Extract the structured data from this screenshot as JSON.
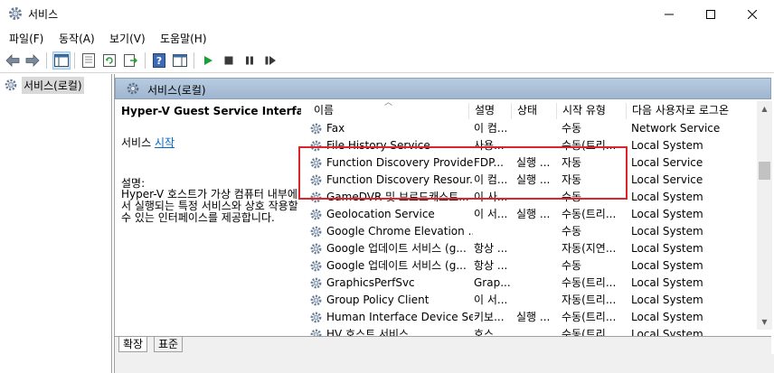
{
  "window": {
    "title": "서비스"
  },
  "menu": [
    "파일(F)",
    "동작(A)",
    "보기(V)",
    "도움말(H)"
  ],
  "tree": {
    "root_label": "서비스(로컬)"
  },
  "pane": {
    "header": "서비스(로컬)"
  },
  "description": {
    "service_name": "Hyper-V Guest Service Interface",
    "start_prefix": "서비스 ",
    "start_link": "시작",
    "label": "설명:",
    "body": "Hyper-V 호스트가 가상 컴퓨터 내부에서 실행되는 특정 서비스와 상호 작용할 수 있는 인터페이스를 제공합니다."
  },
  "columns": {
    "name": "이름",
    "desc": "설명",
    "status": "상태",
    "startup": "시작 유형",
    "logon": "다음 사용자로 로그온"
  },
  "rows": [
    {
      "name": "Fax",
      "desc": "이 컴...",
      "status": "",
      "startup": "수동",
      "logon": "Network Service"
    },
    {
      "name": "File History Service",
      "desc": "사용...",
      "status": "",
      "startup": "수동(트리...",
      "logon": "Local System"
    },
    {
      "name": "Function Discovery Provide...",
      "desc": "FDP...",
      "status": "실행 ...",
      "startup": "자동",
      "logon": "Local Service"
    },
    {
      "name": "Function Discovery Resour...",
      "desc": "이 컴...",
      "status": "실행 ...",
      "startup": "자동",
      "logon": "Local Service"
    },
    {
      "name": "GameDVR 및 브로드캐스트...",
      "desc": "이 사...",
      "status": "",
      "startup": "수동",
      "logon": "Local System"
    },
    {
      "name": "Geolocation Service",
      "desc": "이 서...",
      "status": "실행 ...",
      "startup": "수동(트리...",
      "logon": "Local System"
    },
    {
      "name": "Google Chrome Elevation ...",
      "desc": "",
      "status": "",
      "startup": "수동",
      "logon": "Local System"
    },
    {
      "name": "Google 업데이트 서비스 (g...",
      "desc": "항상 ...",
      "status": "",
      "startup": "자동(지연...",
      "logon": "Local System"
    },
    {
      "name": "Google 업데이트 서비스 (g...",
      "desc": "항상 ...",
      "status": "",
      "startup": "수동",
      "logon": "Local System"
    },
    {
      "name": "GraphicsPerfSvc",
      "desc": "Grap...",
      "status": "",
      "startup": "수동(트리...",
      "logon": "Local System"
    },
    {
      "name": "Group Policy Client",
      "desc": "이 서...",
      "status": "",
      "startup": "자동(트리...",
      "logon": "Local System"
    },
    {
      "name": "Human Interface Device Se...",
      "desc": "키보...",
      "status": "실행 ...",
      "startup": "수동(트리...",
      "logon": "Local System"
    },
    {
      "name": "HV 호스트 서비스",
      "desc": "호스...",
      "status": "",
      "startup": "수동(트리...",
      "logon": "Local System"
    }
  ],
  "tabs": {
    "extended": "확장",
    "standard": "표준"
  },
  "colors": {
    "highlight": "#d9262a",
    "header_bg": "#b8cbe0",
    "link": "#0066cc"
  }
}
